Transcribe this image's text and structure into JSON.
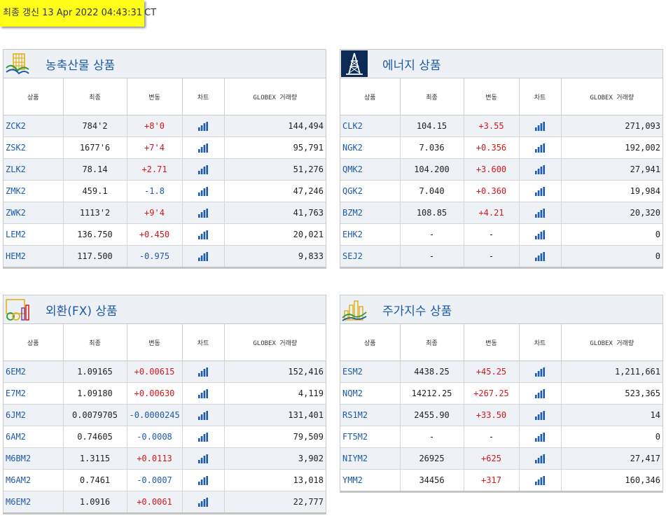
{
  "timestamp": {
    "highlighted": "최종 갱신 13 Apr 2022 04:43:31",
    "suffix": "CT"
  },
  "columns": [
    "상품",
    "최종",
    "변동",
    "차트",
    "GLOBEX 거래량"
  ],
  "colors": {
    "up": "#d4171c",
    "down": "#1d5aa8",
    "title": "#1d5aa8",
    "header_bg": "#edf1f5",
    "row_alt": "#eef2f6",
    "highlight": "#ffff1a"
  },
  "panels": [
    {
      "title": "농축산물 상품",
      "icon": "agriculture-icon",
      "rows": [
        {
          "sym": "ZCK2",
          "last": "784'2",
          "chg": "+8'0",
          "dir": "up",
          "vol": "144,494"
        },
        {
          "sym": "ZSK2",
          "last": "1677'6",
          "chg": "+7'4",
          "dir": "up",
          "vol": "95,791"
        },
        {
          "sym": "ZLK2",
          "last": "78.14",
          "chg": "+2.71",
          "dir": "up",
          "vol": "51,276"
        },
        {
          "sym": "ZMK2",
          "last": "459.1",
          "chg": "-1.8",
          "dir": "down",
          "vol": "47,246"
        },
        {
          "sym": "ZWK2",
          "last": "1113'2",
          "chg": "+9'4",
          "dir": "up",
          "vol": "41,763"
        },
        {
          "sym": "LEM2",
          "last": "136.750",
          "chg": "+0.450",
          "dir": "up",
          "vol": "20,021"
        },
        {
          "sym": "HEM2",
          "last": "117.500",
          "chg": "-0.975",
          "dir": "down",
          "vol": "9,833"
        }
      ]
    },
    {
      "title": "에너지 상품",
      "icon": "oil-derrick-icon",
      "rows": [
        {
          "sym": "CLK2",
          "last": "104.15",
          "chg": "+3.55",
          "dir": "up",
          "vol": "271,093"
        },
        {
          "sym": "NGK2",
          "last": "7.036",
          "chg": "+0.356",
          "dir": "up",
          "vol": "192,002"
        },
        {
          "sym": "QMK2",
          "last": "104.200",
          "chg": "+3.600",
          "dir": "up",
          "vol": "27,941"
        },
        {
          "sym": "QGK2",
          "last": "7.040",
          "chg": "+0.360",
          "dir": "up",
          "vol": "19,984"
        },
        {
          "sym": "BZM2",
          "last": "108.85",
          "chg": "+4.21",
          "dir": "up",
          "vol": "20,320"
        },
        {
          "sym": "EHK2",
          "last": "-",
          "chg": "-",
          "dir": "flat",
          "vol": "0"
        },
        {
          "sym": "SEJ2",
          "last": "-",
          "chg": "-",
          "dir": "flat",
          "vol": "0"
        }
      ]
    },
    {
      "title": "외환(FX) 상품",
      "icon": "currency-fx-icon",
      "rows": [
        {
          "sym": "6EM2",
          "last": "1.09165",
          "chg": "+0.00615",
          "dir": "up",
          "vol": "152,416"
        },
        {
          "sym": "E7M2",
          "last": "1.09180",
          "chg": "+0.00630",
          "dir": "up",
          "vol": "4,119"
        },
        {
          "sym": "6JM2",
          "last": "0.0079705",
          "chg": "-0.0000245",
          "dir": "down",
          "vol": "131,401"
        },
        {
          "sym": "6AM2",
          "last": "0.74605",
          "chg": "-0.0008",
          "dir": "down",
          "vol": "79,509"
        },
        {
          "sym": "M6BM2",
          "last": "1.3115",
          "chg": "+0.0113",
          "dir": "up",
          "vol": "3,902"
        },
        {
          "sym": "M6AM2",
          "last": "0.7461",
          "chg": "-0.0007",
          "dir": "down",
          "vol": "13,018"
        },
        {
          "sym": "M6EM2",
          "last": "1.0916",
          "chg": "+0.0061",
          "dir": "up",
          "vol": "22,777"
        }
      ]
    },
    {
      "title": "주가지수 상품",
      "icon": "stock-index-icon",
      "rows": [
        {
          "sym": "ESM2",
          "last": "4438.25",
          "chg": "+45.25",
          "dir": "up",
          "vol": "1,211,661"
        },
        {
          "sym": "NQM2",
          "last": "14212.25",
          "chg": "+267.25",
          "dir": "up",
          "vol": "523,365"
        },
        {
          "sym": "RS1M2",
          "last": "2455.90",
          "chg": "+33.50",
          "dir": "up",
          "vol": "14"
        },
        {
          "sym": "FT5M2",
          "last": "-",
          "chg": "-",
          "dir": "flat",
          "vol": "0"
        },
        {
          "sym": "NIYM2",
          "last": "26925",
          "chg": "+625",
          "dir": "up",
          "vol": "27,417"
        },
        {
          "sym": "YMM2",
          "last": "34456",
          "chg": "+317",
          "dir": "up",
          "vol": "160,346"
        }
      ]
    }
  ]
}
